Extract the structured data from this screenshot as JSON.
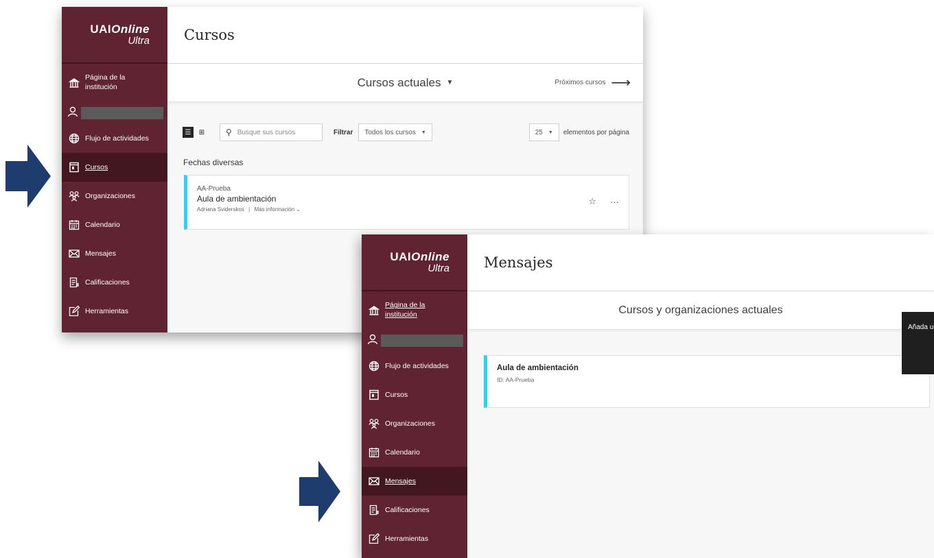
{
  "colors": {
    "sidebar": "#5f2331",
    "sidebar_active": "#43171f",
    "accent_stripe": "#2ad3ef",
    "arrow": "#1f3c6e",
    "tooltip_bg": "#1f1f1f",
    "add_button": "#d79ad9"
  },
  "brand": {
    "name_prefix": "UAI",
    "name_suffix": "Online",
    "tagline": "Ultra"
  },
  "window_cursos": {
    "sidebar": {
      "institution_line1": "Página de la",
      "institution_line2": "institución",
      "items": [
        {
          "label": "Flujo de actividades",
          "icon": "globe-icon"
        },
        {
          "label": "Cursos",
          "icon": "course-icon",
          "active": true
        },
        {
          "label": "Organizaciones",
          "icon": "organizations-icon"
        },
        {
          "label": "Calendario",
          "icon": "calendar-icon"
        },
        {
          "label": "Mensajes",
          "icon": "mail-icon"
        },
        {
          "label": "Calificaciones",
          "icon": "grades-icon"
        },
        {
          "label": "Herramientas",
          "icon": "tools-icon"
        }
      ]
    },
    "title": "Cursos",
    "term_selector": "Cursos actuales",
    "next_courses": "Próximos cursos",
    "search_placeholder": "Busque sus cursos",
    "filter_label": "Filtrar",
    "filter_value": "Todos los cursos",
    "per_page_value": "25",
    "per_page_label": "elementos por página",
    "group_label": "Fechas diversas",
    "course": {
      "id": "AA-Prueba",
      "name": "Aula de ambientación",
      "instructor": "Adriana Sviderskos",
      "separator": "|",
      "more_info": "Más información"
    }
  },
  "window_mensajes": {
    "sidebar": {
      "institution_line1": "Página de la",
      "institution_line2": "institución",
      "items": [
        {
          "label": "Flujo de actividades",
          "icon": "globe-icon"
        },
        {
          "label": "Cursos",
          "icon": "course-icon"
        },
        {
          "label": "Organizaciones",
          "icon": "organizations-icon"
        },
        {
          "label": "Calendario",
          "icon": "calendar-icon"
        },
        {
          "label": "Mensajes",
          "icon": "mail-icon",
          "active": true
        },
        {
          "label": "Calificaciones",
          "icon": "grades-icon"
        },
        {
          "label": "Herramientas",
          "icon": "tools-icon"
        }
      ]
    },
    "title": "Mensajes",
    "subheader": "Cursos y organizaciones actuales",
    "course": {
      "name": "Aula de ambientación",
      "id": "ID: AA-Prueba"
    },
    "tooltip": "Añada un nuevo mensaje."
  }
}
